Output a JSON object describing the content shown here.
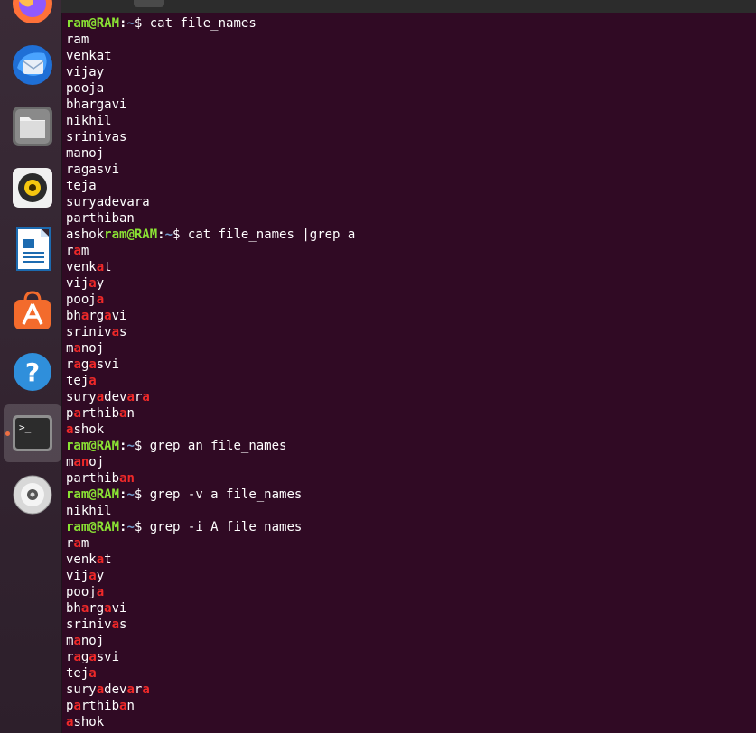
{
  "dock": {
    "items": [
      {
        "name": "firefox"
      },
      {
        "name": "thunderbird"
      },
      {
        "name": "files"
      },
      {
        "name": "rhythmbox"
      },
      {
        "name": "libreoffice-writer"
      },
      {
        "name": "ubuntu-software"
      },
      {
        "name": "help"
      },
      {
        "name": "terminal",
        "active": true
      },
      {
        "name": "dvd"
      }
    ]
  },
  "terminal": {
    "prompt": {
      "user": "ram@RAM",
      "colon": ":",
      "path": "~",
      "symbol": "$ "
    },
    "colors": {
      "background": "#300a24",
      "user": "#8ae234",
      "path": "#729fcf",
      "match": "#ef2929"
    },
    "lines": [
      {
        "cmd": "cat file_names"
      },
      {
        "out": "ram"
      },
      {
        "out": "venkat"
      },
      {
        "out": "vijay"
      },
      {
        "out": "pooja"
      },
      {
        "out": "bhargavi"
      },
      {
        "out": "nikhil"
      },
      {
        "out": "srinivas"
      },
      {
        "out": "manoj"
      },
      {
        "out": "ragasvi"
      },
      {
        "out": "teja"
      },
      {
        "out": "suryadevara"
      },
      {
        "out": "parthiban"
      },
      {
        "lead": "ashok",
        "cmd": "cat file_names |grep a"
      },
      {
        "out": "ram",
        "hl": "a"
      },
      {
        "out": "venkat",
        "hl": "a"
      },
      {
        "out": "vijay",
        "hl": "a"
      },
      {
        "out": "pooja",
        "hl": "a"
      },
      {
        "out": "bhargavi",
        "hl": "a"
      },
      {
        "out": "srinivas",
        "hl": "a"
      },
      {
        "out": "manoj",
        "hl": "a"
      },
      {
        "out": "ragasvi",
        "hl": "a"
      },
      {
        "out": "teja",
        "hl": "a"
      },
      {
        "out": "suryadevara",
        "hl": "a"
      },
      {
        "out": "parthiban",
        "hl": "a"
      },
      {
        "out": "ashok",
        "hl": "a"
      },
      {
        "cmd": "grep an file_names"
      },
      {
        "out": "manoj",
        "hl": "an"
      },
      {
        "out": "parthiban",
        "hl": "an"
      },
      {
        "cmd": "grep -v a file_names"
      },
      {
        "out": "nikhil"
      },
      {
        "cmd": "grep -i A file_names"
      },
      {
        "out": "ram",
        "hl": "a"
      },
      {
        "out": "venkat",
        "hl": "a"
      },
      {
        "out": "vijay",
        "hl": "a"
      },
      {
        "out": "pooja",
        "hl": "a"
      },
      {
        "out": "bhargavi",
        "hl": "a"
      },
      {
        "out": "srinivas",
        "hl": "a"
      },
      {
        "out": "manoj",
        "hl": "a"
      },
      {
        "out": "ragasvi",
        "hl": "a"
      },
      {
        "out": "teja",
        "hl": "a"
      },
      {
        "out": "suryadevara",
        "hl": "a"
      },
      {
        "out": "parthiban",
        "hl": "a"
      },
      {
        "out": "ashok",
        "hl": "a"
      }
    ]
  }
}
